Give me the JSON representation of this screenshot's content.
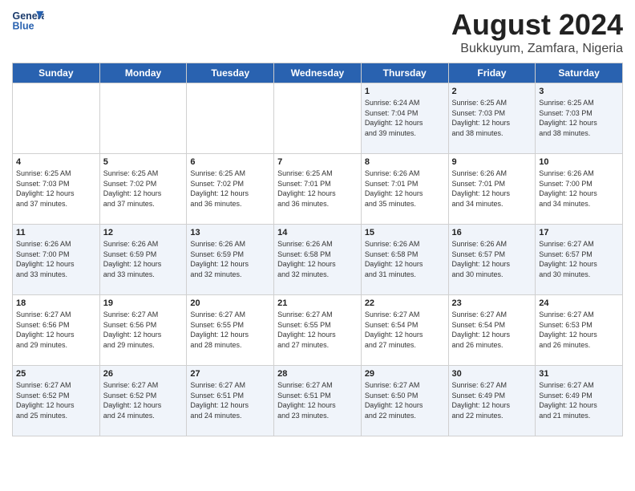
{
  "header": {
    "logo_line1": "General",
    "logo_line2": "Blue",
    "title": "August 2024",
    "subtitle": "Bukkuyum, Zamfara, Nigeria"
  },
  "days_of_week": [
    "Sunday",
    "Monday",
    "Tuesday",
    "Wednesday",
    "Thursday",
    "Friday",
    "Saturday"
  ],
  "weeks": [
    [
      {
        "day": "",
        "info": ""
      },
      {
        "day": "",
        "info": ""
      },
      {
        "day": "",
        "info": ""
      },
      {
        "day": "",
        "info": ""
      },
      {
        "day": "1",
        "info": "Sunrise: 6:24 AM\nSunset: 7:04 PM\nDaylight: 12 hours\nand 39 minutes."
      },
      {
        "day": "2",
        "info": "Sunrise: 6:25 AM\nSunset: 7:03 PM\nDaylight: 12 hours\nand 38 minutes."
      },
      {
        "day": "3",
        "info": "Sunrise: 6:25 AM\nSunset: 7:03 PM\nDaylight: 12 hours\nand 38 minutes."
      }
    ],
    [
      {
        "day": "4",
        "info": "Sunrise: 6:25 AM\nSunset: 7:03 PM\nDaylight: 12 hours\nand 37 minutes."
      },
      {
        "day": "5",
        "info": "Sunrise: 6:25 AM\nSunset: 7:02 PM\nDaylight: 12 hours\nand 37 minutes."
      },
      {
        "day": "6",
        "info": "Sunrise: 6:25 AM\nSunset: 7:02 PM\nDaylight: 12 hours\nand 36 minutes."
      },
      {
        "day": "7",
        "info": "Sunrise: 6:25 AM\nSunset: 7:01 PM\nDaylight: 12 hours\nand 36 minutes."
      },
      {
        "day": "8",
        "info": "Sunrise: 6:26 AM\nSunset: 7:01 PM\nDaylight: 12 hours\nand 35 minutes."
      },
      {
        "day": "9",
        "info": "Sunrise: 6:26 AM\nSunset: 7:01 PM\nDaylight: 12 hours\nand 34 minutes."
      },
      {
        "day": "10",
        "info": "Sunrise: 6:26 AM\nSunset: 7:00 PM\nDaylight: 12 hours\nand 34 minutes."
      }
    ],
    [
      {
        "day": "11",
        "info": "Sunrise: 6:26 AM\nSunset: 7:00 PM\nDaylight: 12 hours\nand 33 minutes."
      },
      {
        "day": "12",
        "info": "Sunrise: 6:26 AM\nSunset: 6:59 PM\nDaylight: 12 hours\nand 33 minutes."
      },
      {
        "day": "13",
        "info": "Sunrise: 6:26 AM\nSunset: 6:59 PM\nDaylight: 12 hours\nand 32 minutes."
      },
      {
        "day": "14",
        "info": "Sunrise: 6:26 AM\nSunset: 6:58 PM\nDaylight: 12 hours\nand 32 minutes."
      },
      {
        "day": "15",
        "info": "Sunrise: 6:26 AM\nSunset: 6:58 PM\nDaylight: 12 hours\nand 31 minutes."
      },
      {
        "day": "16",
        "info": "Sunrise: 6:26 AM\nSunset: 6:57 PM\nDaylight: 12 hours\nand 30 minutes."
      },
      {
        "day": "17",
        "info": "Sunrise: 6:27 AM\nSunset: 6:57 PM\nDaylight: 12 hours\nand 30 minutes."
      }
    ],
    [
      {
        "day": "18",
        "info": "Sunrise: 6:27 AM\nSunset: 6:56 PM\nDaylight: 12 hours\nand 29 minutes."
      },
      {
        "day": "19",
        "info": "Sunrise: 6:27 AM\nSunset: 6:56 PM\nDaylight: 12 hours\nand 29 minutes."
      },
      {
        "day": "20",
        "info": "Sunrise: 6:27 AM\nSunset: 6:55 PM\nDaylight: 12 hours\nand 28 minutes."
      },
      {
        "day": "21",
        "info": "Sunrise: 6:27 AM\nSunset: 6:55 PM\nDaylight: 12 hours\nand 27 minutes."
      },
      {
        "day": "22",
        "info": "Sunrise: 6:27 AM\nSunset: 6:54 PM\nDaylight: 12 hours\nand 27 minutes."
      },
      {
        "day": "23",
        "info": "Sunrise: 6:27 AM\nSunset: 6:54 PM\nDaylight: 12 hours\nand 26 minutes."
      },
      {
        "day": "24",
        "info": "Sunrise: 6:27 AM\nSunset: 6:53 PM\nDaylight: 12 hours\nand 26 minutes."
      }
    ],
    [
      {
        "day": "25",
        "info": "Sunrise: 6:27 AM\nSunset: 6:52 PM\nDaylight: 12 hours\nand 25 minutes."
      },
      {
        "day": "26",
        "info": "Sunrise: 6:27 AM\nSunset: 6:52 PM\nDaylight: 12 hours\nand 24 minutes."
      },
      {
        "day": "27",
        "info": "Sunrise: 6:27 AM\nSunset: 6:51 PM\nDaylight: 12 hours\nand 24 minutes."
      },
      {
        "day": "28",
        "info": "Sunrise: 6:27 AM\nSunset: 6:51 PM\nDaylight: 12 hours\nand 23 minutes."
      },
      {
        "day": "29",
        "info": "Sunrise: 6:27 AM\nSunset: 6:50 PM\nDaylight: 12 hours\nand 22 minutes."
      },
      {
        "day": "30",
        "info": "Sunrise: 6:27 AM\nSunset: 6:49 PM\nDaylight: 12 hours\nand 22 minutes."
      },
      {
        "day": "31",
        "info": "Sunrise: 6:27 AM\nSunset: 6:49 PM\nDaylight: 12 hours\nand 21 minutes."
      }
    ]
  ]
}
